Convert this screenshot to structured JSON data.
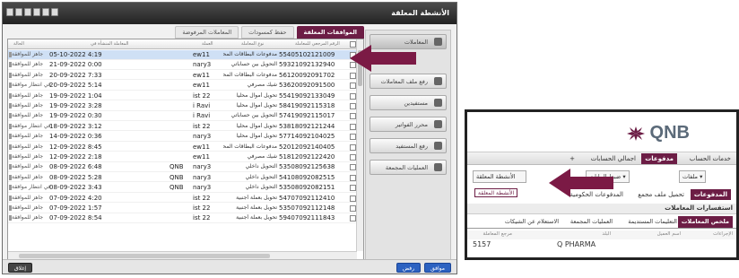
{
  "window": {
    "title": "الأنشطة المعلقة"
  },
  "right_panel": {
    "items": [
      {
        "label": "المعاملات",
        "icon": "transactions-icon"
      },
      {
        "label": "رفع ملف المعاملات",
        "icon": "upload-file-icon"
      },
      {
        "label": "مستفيدين",
        "icon": "beneficiaries-icon"
      },
      {
        "label": "محرر الفواتير",
        "icon": "invoice-editor-icon"
      },
      {
        "label": "رفع المستفيد",
        "icon": "upload-beneficiary-icon"
      },
      {
        "label": "العمليات المجمعة",
        "icon": "bulk-operations-icon"
      }
    ]
  },
  "tabs": [
    "الموافقات المعلقة",
    "حفظ كمسودات",
    "المعاملات المرفوضة"
  ],
  "table": {
    "headers": {
      "number": "الرقم المرجعي للمعاملة",
      "category": "نوع المعاملة",
      "currency": "العملة",
      "reference": "المرجع",
      "date": "المعاملة المنشأة في",
      "status": "الحالة"
    },
    "rows": [
      {
        "number": "55405102121009",
        "category": "مدفوعات البطاقات المحلية",
        "currency": "ew11",
        "reference": "",
        "date": "05-10-2022 4:19",
        "status": "جاهز للموافقة",
        "selected": true
      },
      {
        "number": "59321092132940",
        "category": "التحويل بين حساباتي",
        "currency": "nary3",
        "reference": "",
        "date": "21-09-2022 0:00",
        "status": "جاهز للموافقة"
      },
      {
        "number": "56120092091702",
        "category": "مدفوعات البطاقات المحلية",
        "currency": "ew11",
        "reference": "",
        "date": "20-09-2022 7:33",
        "status": "جاهز للموافقة"
      },
      {
        "number": "53620092091500",
        "category": "شيك مصرفي",
        "currency": "ew11",
        "reference": "",
        "date": "20-09-2022 5:14",
        "status": "في انتظار موافقة"
      },
      {
        "number": "55419092133049",
        "category": "تحويل أموال محلياً",
        "currency": "ist 22",
        "reference": "",
        "date": "19-09-2022 1:04",
        "status": "جاهز للموافقة"
      },
      {
        "number": "58419092115318",
        "category": "تحويل أموال محلياً",
        "currency": "i Ravi",
        "reference": "",
        "date": "19-09-2022 3:28",
        "status": "جاهز للموافقة"
      },
      {
        "number": "57419092115017",
        "category": "التحويل بين حساباتي",
        "currency": "i Ravi",
        "reference": "",
        "date": "19-09-2022 0:30",
        "status": "جاهز للموافقة"
      },
      {
        "number": "53818092121244",
        "category": "تحويل أموال محلياً",
        "currency": "ist 22",
        "reference": "",
        "date": "18-09-2022 3:12",
        "status": "في انتظار موافقة"
      },
      {
        "number": "57714092104025",
        "category": "تحويل أموال محلياً",
        "currency": "nary3",
        "reference": "",
        "date": "14-09-2022 0:36",
        "status": "جاهز للموافقة"
      },
      {
        "number": "52012092140405",
        "category": "مدفوعات البطاقات المحلية",
        "currency": "ew11",
        "reference": "",
        "date": "12-09-2022 8:45",
        "status": "جاهز للموافقة"
      },
      {
        "number": "51812092122420",
        "category": "شيك مصرفي",
        "currency": "ew11",
        "reference": "",
        "date": "12-09-2022 2:18",
        "status": "جاهز للموافقة"
      },
      {
        "number": "53508092125638",
        "category": "التحويل داخلي",
        "currency": "nary3",
        "reference": "QNB",
        "date": "08-09-2022 6:48",
        "status": "جاهز للموافقة"
      },
      {
        "number": "54108092082515",
        "category": "التحويل داخلي",
        "currency": "nary3",
        "reference": "QNB",
        "date": "08-09-2022 5:28",
        "status": "جاهز للموافقة"
      },
      {
        "number": "53508092082151",
        "category": "التحويل داخلي",
        "currency": "nary3",
        "reference": "QNB",
        "date": "08-09-2022 3:43",
        "status": "في انتظار موافقة"
      },
      {
        "number": "54707092112410",
        "category": "تحويل بعملة أجنبية",
        "currency": "ist 22",
        "reference": "",
        "date": "07-09-2022 4:20",
        "status": "جاهز للموافقة"
      },
      {
        "number": "53507092112148",
        "category": "تحويل بعملة أجنبية",
        "currency": "ist 22",
        "reference": "",
        "date": "07-09-2022 1:57",
        "status": "جاهز للموافقة"
      },
      {
        "number": "59407092111843",
        "category": "تحويل بعملة أجنبية",
        "currency": "ist 22",
        "reference": "",
        "date": "07-09-2022 8:54",
        "status": "جاهز للموافقة"
      }
    ]
  },
  "footer": {
    "agree": "موافق",
    "reject": "رفض",
    "close": "إغلاق"
  },
  "inset": {
    "logo": "QNB",
    "menu": [
      "خدمات الحساب",
      "مدفوعات",
      "اجمالي الحسابات",
      "+"
    ],
    "tools": [
      "الأنشطة المعلقة",
      "ضبط البيانات ▾",
      "ملفات ▾"
    ],
    "subnav": [
      "المدفوعات",
      "تحميل ملف مجمع",
      "المدفوعات الحكومية"
    ],
    "badge": "الأنشطة المعلقة",
    "inquiry": "استفسارات المعاملات",
    "tabs2": [
      "ملخص المعاملات",
      "التعليمات المستديمة",
      "العمليات المجمعة",
      "الاستعلام عن الشيكات"
    ],
    "colhdr": [
      "الإجراءات",
      "اسم العميل",
      "البلد",
      "مرجع المعاملة"
    ],
    "first_row": [
      "Q PHARMA",
      "5157"
    ]
  },
  "colors": {
    "accent": "#6c1d45",
    "arrow": "#7b1a45",
    "button_blue": "#2c62c1"
  }
}
